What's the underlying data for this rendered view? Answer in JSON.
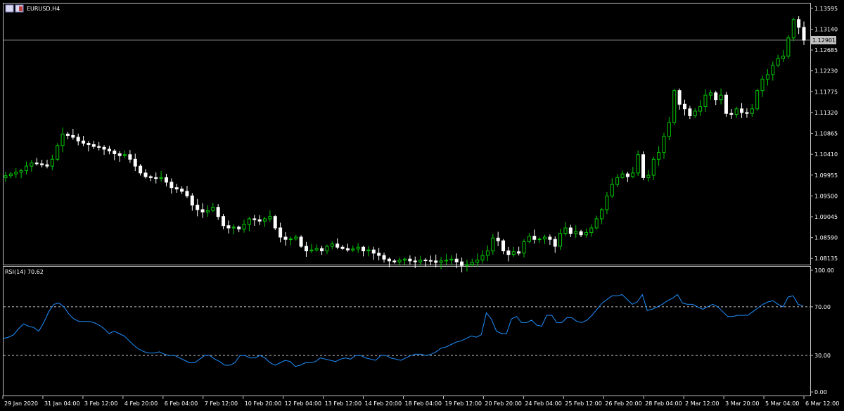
{
  "chart_data": [
    {
      "type": "candlestick",
      "symbol_title": "EURUSD,H4",
      "bid_line_label": "1.12901",
      "ylim": [
        1.08,
        1.137
      ],
      "y_ticks": [
        "1.13595",
        "1.13140",
        "1.12685",
        "1.12230",
        "1.11775",
        "1.11320",
        "1.10865",
        "1.10410",
        "1.09955",
        "1.09500",
        "1.09045",
        "1.08590",
        "1.08135"
      ],
      "up_color": "#00c800",
      "down_color": "#ffffff",
      "bid_line_color": "#808080",
      "close": [
        1.0994,
        1.0998,
        1.1002,
        1.1005,
        1.1015,
        1.1022,
        1.102,
        1.1018,
        1.1015,
        1.103,
        1.106,
        1.1085,
        1.1082,
        1.1078,
        1.107,
        1.1065,
        1.1062,
        1.1058,
        1.1056,
        1.1052,
        1.1048,
        1.1042,
        1.1038,
        1.104,
        1.103,
        1.1015,
        1.1,
        1.0992,
        1.099,
        1.0988,
        1.099,
        1.098,
        1.0968,
        1.0965,
        1.096,
        1.095,
        1.093,
        1.092,
        1.0915,
        1.0918,
        1.0925,
        1.0905,
        1.0885,
        1.088,
        1.0882,
        1.0878,
        1.0888,
        1.09,
        1.0898,
        1.0895,
        1.09,
        1.0905,
        1.088,
        1.086,
        1.0855,
        1.0856,
        1.086,
        1.084,
        1.083,
        1.0832,
        1.0835,
        1.083,
        1.084,
        1.0845,
        1.0838,
        1.0835,
        1.0832,
        1.0834,
        1.0838,
        1.083,
        1.0832,
        1.0825,
        1.082,
        1.0812,
        1.0808,
        1.0806,
        1.081,
        1.0812,
        1.0808,
        1.0806,
        1.081,
        1.0809,
        1.0808,
        1.0805,
        1.0808,
        1.081,
        1.0812,
        1.0806,
        1.0798,
        1.08,
        1.0805,
        1.081,
        1.082,
        1.083,
        1.0858,
        1.0852,
        1.083,
        1.0822,
        1.0828,
        1.0825,
        1.085,
        1.0862,
        1.0855,
        1.0856,
        1.086,
        1.0855,
        1.084,
        1.0868,
        1.088,
        1.0868,
        1.0872,
        1.0865,
        1.087,
        1.088,
        1.09,
        1.092,
        1.095,
        1.0975,
        1.099,
        1.0998,
        1.0992,
        1.1,
        1.104,
        1.099,
        1.0995,
        1.103,
        1.1045,
        1.108,
        1.111,
        1.118,
        1.115,
        1.114,
        1.1125,
        1.1135,
        1.1145,
        1.117,
        1.1175,
        1.116,
        1.117,
        1.113,
        1.1128,
        1.114,
        1.1132,
        1.113,
        1.114,
        1.118,
        1.1205,
        1.1215,
        1.1235,
        1.125,
        1.1255,
        1.1295,
        1.1335,
        1.1318,
        1.129
      ],
      "rsi": {
        "label": "RSI(14) 70.62",
        "ylim": [
          0,
          100
        ],
        "tick_labels": [
          "100.00",
          "70.00",
          "30.00",
          "0.00"
        ],
        "levels": [
          70,
          30
        ],
        "line_color": "#1e90ff",
        "values": [
          44,
          45,
          47,
          52,
          56,
          54,
          53,
          50,
          57,
          66,
          72,
          73,
          70,
          64,
          60,
          58,
          58,
          58,
          57,
          55,
          52,
          48,
          50,
          48,
          46,
          42,
          38,
          35,
          33,
          32,
          32,
          33,
          31,
          30,
          30,
          28,
          26,
          24,
          24,
          27,
          30,
          30,
          27,
          25,
          22,
          22,
          24,
          30,
          30,
          28,
          28,
          30,
          28,
          24,
          22,
          24,
          26,
          25,
          21,
          22,
          24,
          24,
          25,
          28,
          27,
          26,
          25,
          27,
          28,
          27,
          30,
          30,
          28,
          27,
          26,
          30,
          30,
          28,
          27,
          26,
          28,
          30,
          31,
          31,
          30,
          31,
          33,
          36,
          37,
          39,
          41,
          42,
          44,
          46,
          45,
          47,
          65,
          60,
          50,
          48,
          48,
          60,
          62,
          57,
          57,
          59,
          55,
          54,
          63,
          63,
          57,
          57,
          61,
          61,
          58,
          57,
          59,
          63,
          68,
          73,
          76,
          79,
          79,
          80,
          76,
          72,
          74,
          80,
          67,
          68,
          70,
          72,
          75,
          77,
          80,
          73,
          72,
          72,
          70,
          68,
          70,
          72,
          70,
          66,
          62,
          62,
          63,
          63,
          63,
          66,
          69,
          72,
          74,
          75,
          72,
          70,
          78,
          79,
          72,
          70.62
        ]
      },
      "x_tick_labels": [
        "29 Jan 2020",
        "31 Jan 04:00",
        "3 Feb 12:00",
        "4 Feb 20:00",
        "6 Feb 04:00",
        "7 Feb 12:00",
        "10 Feb 20:00",
        "12 Feb 04:00",
        "13 Feb 12:00",
        "14 Feb 20:00",
        "18 Feb 04:00",
        "19 Feb 12:00",
        "20 Feb 20:00",
        "24 Feb 04:00",
        "25 Feb 12:00",
        "26 Feb 20:00",
        "28 Feb 04:00",
        "2 Mar 12:00",
        "3 Mar 20:00",
        "5 Mar 04:00",
        "6 Mar 12:00"
      ],
      "grid": false,
      "level_line_color": "#c0c0c0"
    }
  ]
}
